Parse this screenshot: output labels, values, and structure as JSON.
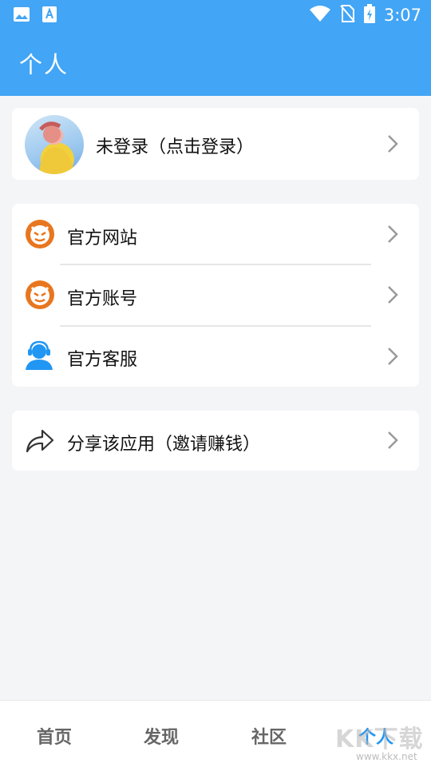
{
  "status_bar": {
    "time": "3:07",
    "icons": [
      "image-icon",
      "font-app-icon",
      "wifi-icon",
      "no-sim-icon",
      "battery-charging-icon"
    ]
  },
  "header": {
    "title": "个人"
  },
  "profile": {
    "label": "未登录（点击登录）"
  },
  "menu": [
    {
      "label": "官方网站",
      "icon": "devil-logo-icon"
    },
    {
      "label": "官方账号",
      "icon": "devil-logo-icon"
    },
    {
      "label": "官方客服",
      "icon": "customer-service-icon"
    }
  ],
  "share": {
    "label": "分享该应用（邀请赚钱）",
    "icon": "share-icon"
  },
  "bottom_nav": {
    "items": [
      "首页",
      "发现",
      "社区",
      "个人"
    ],
    "active": "个人"
  },
  "watermark": {
    "main": "KK下载",
    "sub": "www.kkx.net"
  },
  "colors": {
    "primary": "#42a5f5",
    "active_tab": "#2196f3",
    "logo_orange": "#e8761e"
  }
}
